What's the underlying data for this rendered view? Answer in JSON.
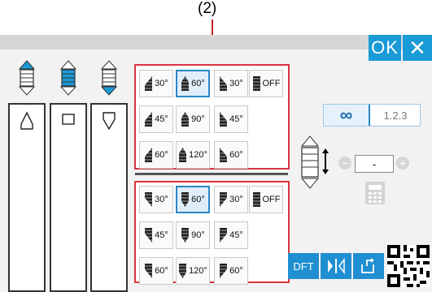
{
  "callout": {
    "label": "(2)"
  },
  "toolbar": {
    "ok_label": "OK",
    "close_label": "✕"
  },
  "panel_top": {
    "buttons": [
      {
        "label": "30°"
      },
      {
        "label": "60°",
        "selected": true
      },
      {
        "label": "30°"
      },
      {
        "label": "OFF"
      },
      {
        "label": "45°"
      },
      {
        "label": "90°"
      },
      {
        "label": "45°"
      },
      {
        "label": "60°"
      },
      {
        "label": "120°"
      },
      {
        "label": "60°"
      }
    ]
  },
  "panel_bottom": {
    "buttons": [
      {
        "label": "30°"
      },
      {
        "label": "60°",
        "selected": true
      },
      {
        "label": "30°"
      },
      {
        "label": "OFF"
      },
      {
        "label": "45°"
      },
      {
        "label": "90°"
      },
      {
        "label": "45°"
      },
      {
        "label": "60°"
      },
      {
        "label": "120°"
      },
      {
        "label": "60°"
      }
    ]
  },
  "mode": {
    "infinite_label": "∞",
    "count_label": "1.2.3"
  },
  "length": {
    "value": "-",
    "minus_label": "−",
    "plus_label": "+"
  },
  "bottom_bar": {
    "dft_label": "DFT"
  },
  "colors": {
    "accent": "#1a9ad6",
    "panel_border": "#d9343f",
    "selected_border": "#2a86c6"
  }
}
